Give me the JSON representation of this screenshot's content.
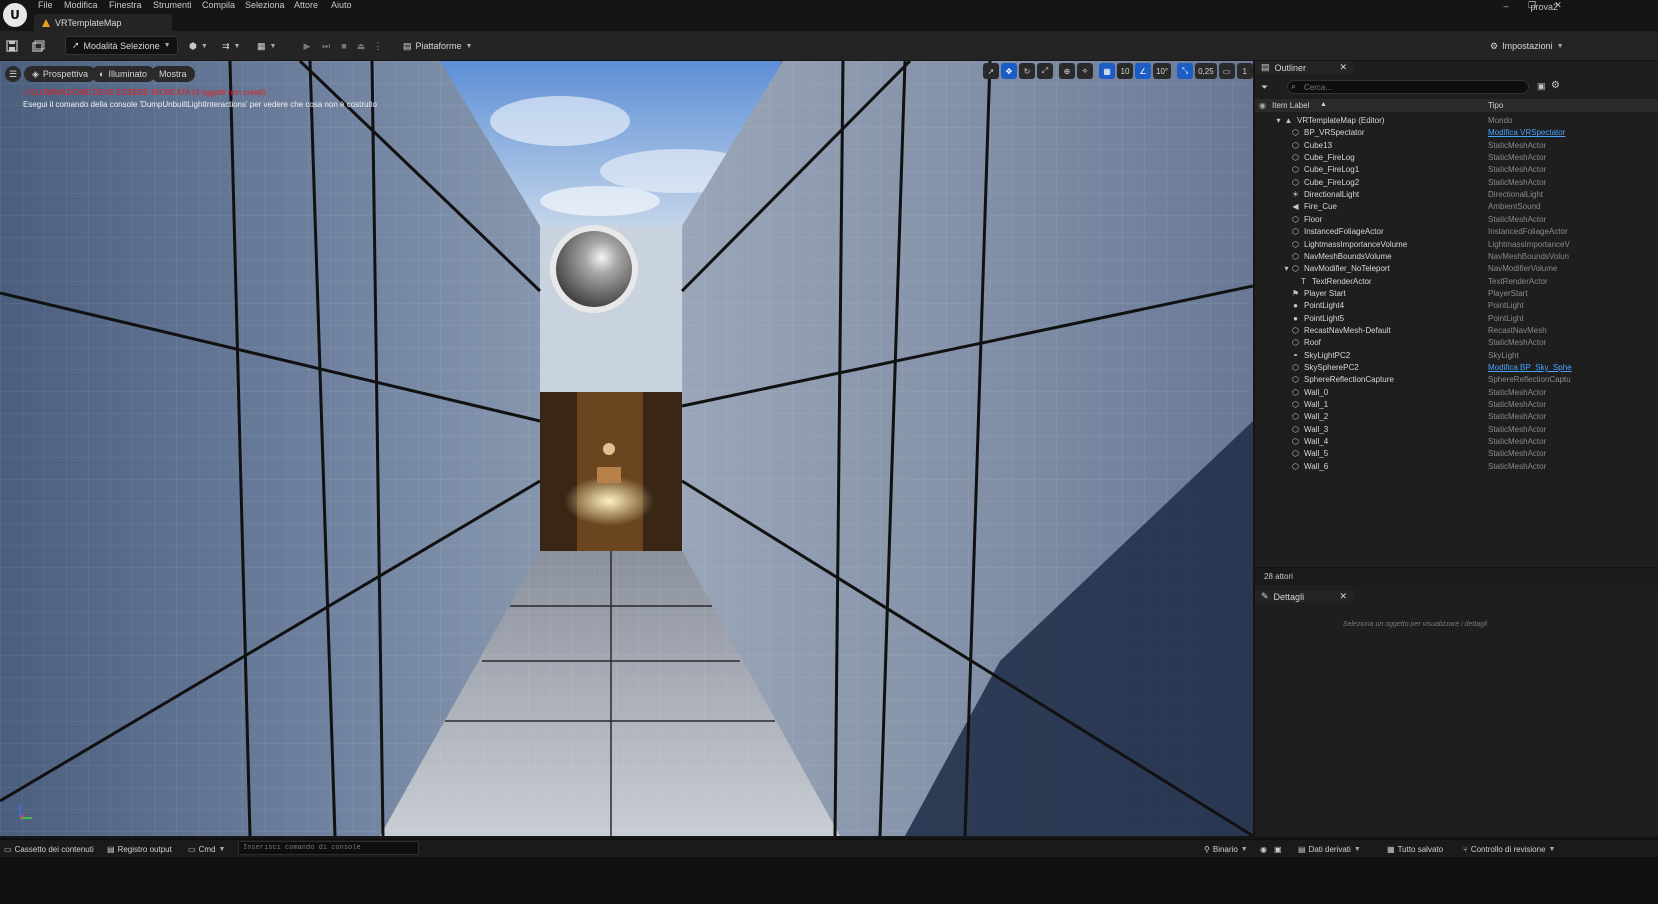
{
  "menu": {
    "items": [
      "File",
      "Modifica",
      "Finestra",
      "Strumenti",
      "Compila",
      "Seleziona",
      "Attore",
      "Aiuto"
    ]
  },
  "document_tab": {
    "title": "VRTemplateMap"
  },
  "project_name": "prova2",
  "window_controls": {
    "minimize": "–",
    "maximize": "❐",
    "close": "✕"
  },
  "toolbar": {
    "mode_label": "Modalità Selezione",
    "platforms_label": "Piattaforme",
    "settings_label": "Impostazioni"
  },
  "viewport": {
    "perspective_label": "Prospettiva",
    "lit_label": "Illuminato",
    "show_label": "Mostra",
    "warning_lighting": "L'ILLUMINAZIONE DEVE ESSERE RICREATA (4 oggetti non creati)",
    "warning_console": "Esegui il comando della console 'DumpUnbuiltLightInteractions' per vedere che cosa non è costruito",
    "grid_snap_value": "10",
    "rotation_snap_value": "10°",
    "scale_snap_value": "0,25",
    "camera_speed_value": "1"
  },
  "outliner": {
    "tab_label": "Outliner",
    "search_placeholder": "Cerca...",
    "col_label": "Item Label",
    "col_type": "Tipo",
    "root": {
      "label": "VRTemplateMap (Editor)",
      "type": "Mondo"
    },
    "rows": [
      {
        "label": "BP_VRSpectator",
        "type": "Modifica VRSpectator",
        "link": true
      },
      {
        "label": "Cube13",
        "type": "StaticMeshActor"
      },
      {
        "label": "Cube_FireLog",
        "type": "StaticMeshActor"
      },
      {
        "label": "Cube_FireLog1",
        "type": "StaticMeshActor"
      },
      {
        "label": "Cube_FireLog2",
        "type": "StaticMeshActor"
      },
      {
        "label": "DirectionalLight",
        "type": "DirectionalLight"
      },
      {
        "label": "Fire_Cue",
        "type": "AmbientSound"
      },
      {
        "label": "Floor",
        "type": "StaticMeshActor"
      },
      {
        "label": "InstancedFoliageActor",
        "type": "InstancedFoliageActor"
      },
      {
        "label": "LightmassImportanceVolume",
        "type": "LightmassImportanceV"
      },
      {
        "label": "NavMeshBoundsVolume",
        "type": "NavMeshBoundsVolun"
      },
      {
        "label": "NavModifier_NoTeleport",
        "type": "NavModifierVolume"
      },
      {
        "label": "TextRenderActor",
        "type": "TextRenderActor",
        "child": true
      },
      {
        "label": "Player Start",
        "type": "PlayerStart"
      },
      {
        "label": "PointLight4",
        "type": "PointLight"
      },
      {
        "label": "PointLight5",
        "type": "PointLight"
      },
      {
        "label": "RecastNavMesh-Default",
        "type": "RecastNavMesh"
      },
      {
        "label": "Roof",
        "type": "StaticMeshActor"
      },
      {
        "label": "SkyLightPC2",
        "type": "SkyLight"
      },
      {
        "label": "SkySpherePC2",
        "type": "Modifica BP_Sky_Sphe",
        "link": true
      },
      {
        "label": "SphereReflectionCapture",
        "type": "SphereReflectionCaptu"
      },
      {
        "label": "Wall_0",
        "type": "StaticMeshActor"
      },
      {
        "label": "Wall_1",
        "type": "StaticMeshActor"
      },
      {
        "label": "Wall_2",
        "type": "StaticMeshActor"
      },
      {
        "label": "Wall_3",
        "type": "StaticMeshActor"
      },
      {
        "label": "Wall_4",
        "type": "StaticMeshActor"
      },
      {
        "label": "Wall_5",
        "type": "StaticMeshActor"
      },
      {
        "label": "Wall_6",
        "type": "StaticMeshActor"
      }
    ],
    "footer": "28 attori"
  },
  "details": {
    "tab_label": "Dettagli",
    "hint": "Seleziona un oggetto per visualizzare i dettagli"
  },
  "statusbar": {
    "content_drawer": "Cassetto dei contenuti",
    "output_log": "Registro output",
    "cmd": "Cmd",
    "console_placeholder": "Inserisci comando di console",
    "binary": "Binario",
    "derived_data": "Dati derivati",
    "all_saved": "Tutto salvato",
    "revision_control": "Controllo di revisione"
  }
}
